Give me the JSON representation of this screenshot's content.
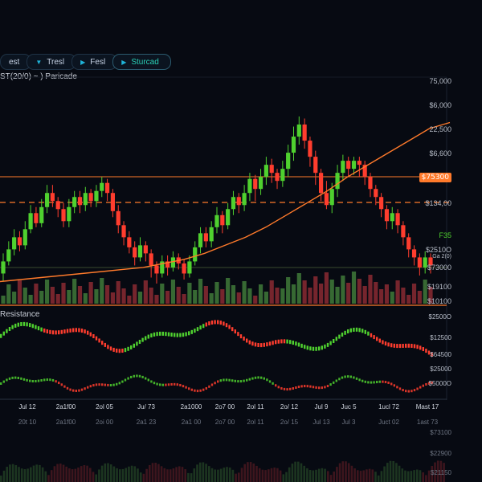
{
  "breadcrumbs": [
    {
      "label": "est",
      "icon": "tab-icon"
    },
    {
      "label": "Tresl",
      "icon": "shield-icon"
    },
    {
      "label": "Fesl",
      "icon": "play-icon"
    },
    {
      "label": "Sturcad",
      "icon": "play-icon"
    }
  ],
  "main": {
    "title": "ST(20/0) ~ ) Paricade"
  },
  "indicator": {
    "label": "Resistance"
  },
  "price_axis": [
    "75,000",
    "$6,000",
    "22,500",
    "$6,600",
    "$134,00",
    "F35",
    "$2510O",
    "Ga 2(0)",
    "$73000",
    "$19100",
    "$10100"
  ],
  "price_badge": "$75300",
  "indicator_axis": [
    "$2500O",
    "$12500",
    "$64500",
    "$25000",
    "$5000O"
  ],
  "x_axis": [
    "Jul 12",
    "2a1f00",
    "2ol 05",
    "Ju/ 73",
    "2a1000",
    "2o7 00",
    "2ol 11",
    "2o/ 12",
    "Jul 9",
    "Juc 5",
    "1ucl 72",
    "Mast 17"
  ],
  "x_axis_secondary": [
    "20t 10",
    "2a1f00",
    "2oi 00",
    "2a1 23",
    "2a1 00",
    "2o7 00",
    "2ol 11",
    "2o/ 15",
    "Jul 13",
    "Jul 3",
    "Juct 02",
    "1ast 73"
  ],
  "lower_axis": [
    "$73100",
    "$22900",
    "$21150"
  ],
  "colors": {
    "up": "#4fd12f",
    "down": "#ff3d2e",
    "ma": "#ff7a2b",
    "resistance": "#ff7a2b"
  },
  "chart_data": {
    "type": "candlestick",
    "candles": [
      [
        22,
        28,
        18,
        32
      ],
      [
        28,
        34,
        26,
        38
      ],
      [
        34,
        40,
        31,
        44
      ],
      [
        40,
        36,
        33,
        43
      ],
      [
        36,
        44,
        34,
        48
      ],
      [
        44,
        52,
        42,
        56
      ],
      [
        52,
        47,
        45,
        55
      ],
      [
        47,
        55,
        45,
        59
      ],
      [
        55,
        62,
        52,
        66
      ],
      [
        62,
        58,
        55,
        66
      ],
      [
        58,
        54,
        50,
        60
      ],
      [
        54,
        48,
        45,
        57
      ],
      [
        48,
        55,
        45,
        59
      ],
      [
        55,
        60,
        52,
        63
      ],
      [
        60,
        56,
        52,
        63
      ],
      [
        56,
        62,
        53,
        65
      ],
      [
        62,
        58,
        55,
        64
      ],
      [
        58,
        63,
        55,
        66
      ],
      [
        63,
        67,
        60,
        70
      ],
      [
        67,
        62,
        58,
        69
      ],
      [
        62,
        53,
        50,
        64
      ],
      [
        53,
        46,
        42,
        56
      ],
      [
        46,
        40,
        36,
        48
      ],
      [
        40,
        35,
        32,
        43
      ],
      [
        35,
        30,
        26,
        38
      ],
      [
        30,
        36,
        28,
        40
      ],
      [
        36,
        32,
        28,
        38
      ],
      [
        32,
        26,
        20,
        34
      ],
      [
        26,
        22,
        17,
        28
      ],
      [
        22,
        28,
        20,
        31
      ],
      [
        28,
        25,
        21,
        31
      ],
      [
        25,
        30,
        23,
        33
      ],
      [
        30,
        27,
        24,
        32
      ],
      [
        27,
        22,
        19,
        29
      ],
      [
        22,
        28,
        20,
        31
      ],
      [
        28,
        35,
        26,
        38
      ],
      [
        35,
        42,
        32,
        45
      ],
      [
        42,
        38,
        35,
        45
      ],
      [
        38,
        45,
        35,
        48
      ],
      [
        45,
        51,
        42,
        55
      ],
      [
        51,
        46,
        42,
        53
      ],
      [
        46,
        54,
        44,
        57
      ],
      [
        54,
        60,
        51,
        63
      ],
      [
        60,
        56,
        52,
        62
      ],
      [
        56,
        62,
        53,
        66
      ],
      [
        62,
        69,
        58,
        72
      ],
      [
        69,
        64,
        58,
        71
      ],
      [
        64,
        70,
        61,
        74
      ],
      [
        70,
        76,
        66,
        80
      ],
      [
        76,
        72,
        67,
        79
      ],
      [
        72,
        68,
        64,
        74
      ],
      [
        68,
        74,
        65,
        78
      ],
      [
        74,
        82,
        70,
        86
      ],
      [
        82,
        90,
        78,
        95
      ],
      [
        90,
        96,
        86,
        100
      ],
      [
        96,
        88,
        84,
        99
      ],
      [
        88,
        80,
        75,
        90
      ],
      [
        80,
        72,
        66,
        83
      ],
      [
        72,
        62,
        58,
        74
      ],
      [
        62,
        56,
        54,
        68
      ],
      [
        56,
        64,
        52,
        67
      ],
      [
        64,
        72,
        60,
        76
      ],
      [
        72,
        78,
        68,
        81
      ],
      [
        78,
        74,
        70,
        80
      ],
      [
        74,
        78,
        71,
        80
      ],
      [
        78,
        76,
        70,
        80
      ],
      [
        76,
        70,
        66,
        78
      ],
      [
        70,
        64,
        60,
        72
      ],
      [
        64,
        60,
        56,
        66
      ],
      [
        60,
        54,
        50,
        62
      ],
      [
        54,
        48,
        44,
        56
      ],
      [
        48,
        52,
        44,
        55
      ],
      [
        52,
        46,
        42,
        54
      ],
      [
        46,
        40,
        36,
        48
      ],
      [
        40,
        34,
        30,
        42
      ],
      [
        34,
        30,
        26,
        36
      ],
      [
        30,
        25,
        21,
        32
      ],
      [
        25,
        30,
        22,
        33
      ],
      [
        30,
        26,
        22,
        32
      ]
    ],
    "moving_average": [
      8,
      9,
      10,
      11,
      12,
      13,
      14,
      15,
      17,
      19,
      22,
      26,
      30,
      35,
      41,
      47,
      53,
      60,
      66,
      72,
      78,
      84,
      87
    ],
    "resistance_levels": [
      "$75300",
      "$134,00"
    ]
  }
}
